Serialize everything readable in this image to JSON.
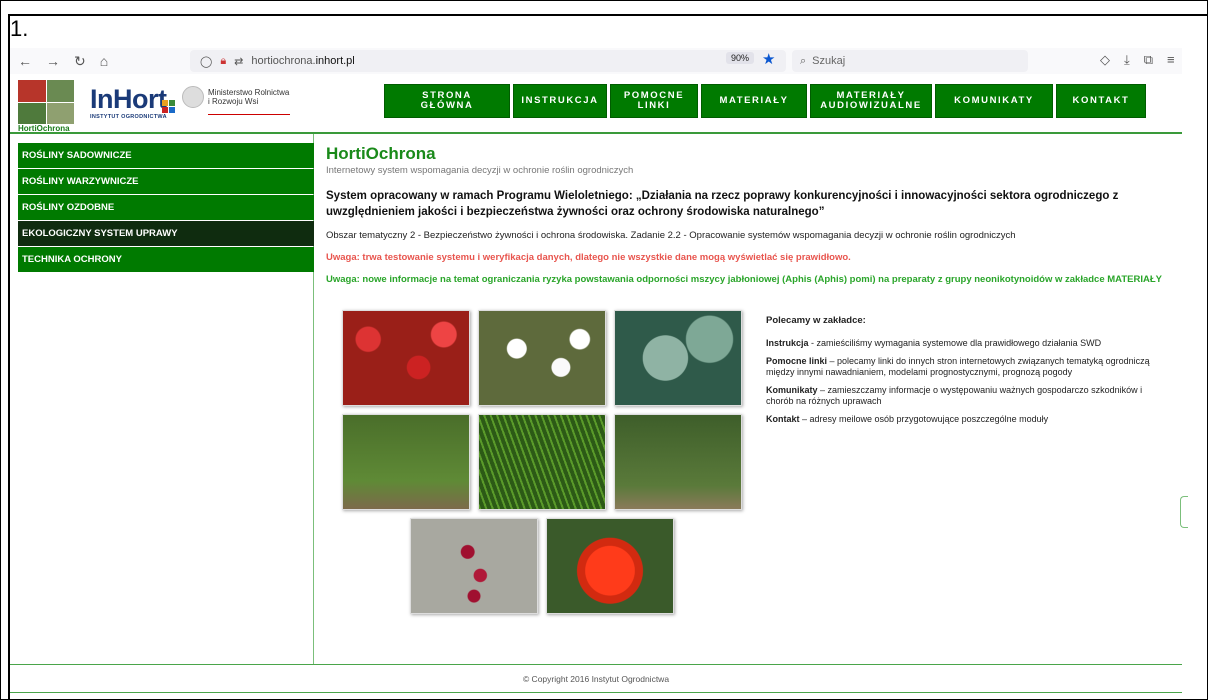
{
  "figure_label": "1.",
  "browser": {
    "url_prefix": "hortiochrona.",
    "url_domain": "inhort.pl",
    "zoom": "90%",
    "search_placeholder": "Szukaj"
  },
  "header": {
    "logo_caption": "HortiOchrona",
    "inhort_logo": "InHort",
    "inhort_sub": "INSTYTUT OGRODNICTWA",
    "ministry_line1": "Ministerstwo Rolnictwa",
    "ministry_line2": "i Rozwoju Wsi",
    "nav": [
      {
        "line1": "STRONA",
        "line2": "GŁÓWNA"
      },
      {
        "line1": "INSTRUKCJA",
        "line2": ""
      },
      {
        "line1": "POMOCNE",
        "line2": "LINKI"
      },
      {
        "line1": "MATERIAŁY",
        "line2": ""
      },
      {
        "line1": "MATERIAŁY",
        "line2": "AUDIOWIZUALNE"
      },
      {
        "line1": "KOMUNIKATY",
        "line2": ""
      },
      {
        "line1": "KONTAKT",
        "line2": ""
      }
    ]
  },
  "sidebar": {
    "items": [
      {
        "label": "ROŚLINY SADOWNICZE"
      },
      {
        "label": "ROŚLINY WARZYWNICZE"
      },
      {
        "label": "ROŚLINY OZDOBNE"
      },
      {
        "label": "EKOLOGICZNY SYSTEM UPRAWY"
      },
      {
        "label": "TECHNIKA OCHRONY"
      }
    ]
  },
  "main": {
    "title": "HortiOchrona",
    "tagline": "Internetowy system wspomagania decyzji w ochronie roślin ogrodniczych",
    "program": "System opracowany w ramach Programu Wieloletniego: „Działania na rzecz poprawy konkurencyjności i innowacyjności sektora ogrodniczego z uwzględnieniem jakości i bezpieczeństwa żywności oraz ochrony środowiska naturalnego”",
    "area": "Obszar tematyczny 2 - Bezpieczeństwo żywności i ochrona środowiska. Zadanie 2.2 - Opracowanie systemów wspomagania decyzji w ochronie roślin ogrodniczych",
    "warning_red": "Uwaga: trwa testowanie systemu i weryfikacja danych, dlatego nie wszystkie dane mogą wyświetlać się prawidłowo.",
    "warning_green": "Uwaga: nowe informacje na temat ograniczania ryzyka powstawania odporności mszycy jabłoniowej (Aphis (Aphis) pomi) na preparaty z grupy neonikotynoidów w zakładce MATERIAŁY"
  },
  "recommend": {
    "heading": "Polecamy w zakładce:",
    "items": [
      {
        "term": "Instrukcja",
        "text": " - zamieściliśmy wymagania systemowe dla prawidłowego działania SWD"
      },
      {
        "term": "Pomocne linki",
        "text": " – polecamy linki do innych stron internetowych związanych tematyką ogrodniczą między innymi nawadnianiem, modelami prognostycznymi, prognozą pogody"
      },
      {
        "term": "Komunikaty",
        "text": " – zamieszczamy informacje o występowaniu ważnych gospodarczo szkodników i chorób na różnych uprawach"
      },
      {
        "term": "Kontakt",
        "text": " – adresy meilowe osób przygotowujące poszczególne moduły"
      }
    ]
  },
  "footer": {
    "copyright": "© Copyright 2016 Instytut Ogrodnictwa"
  },
  "colors": {
    "brand_green": "#007a00",
    "active_dark": "#0f2c0f",
    "warning_red": "#e8554e",
    "warning_green": "#2aa52a"
  }
}
